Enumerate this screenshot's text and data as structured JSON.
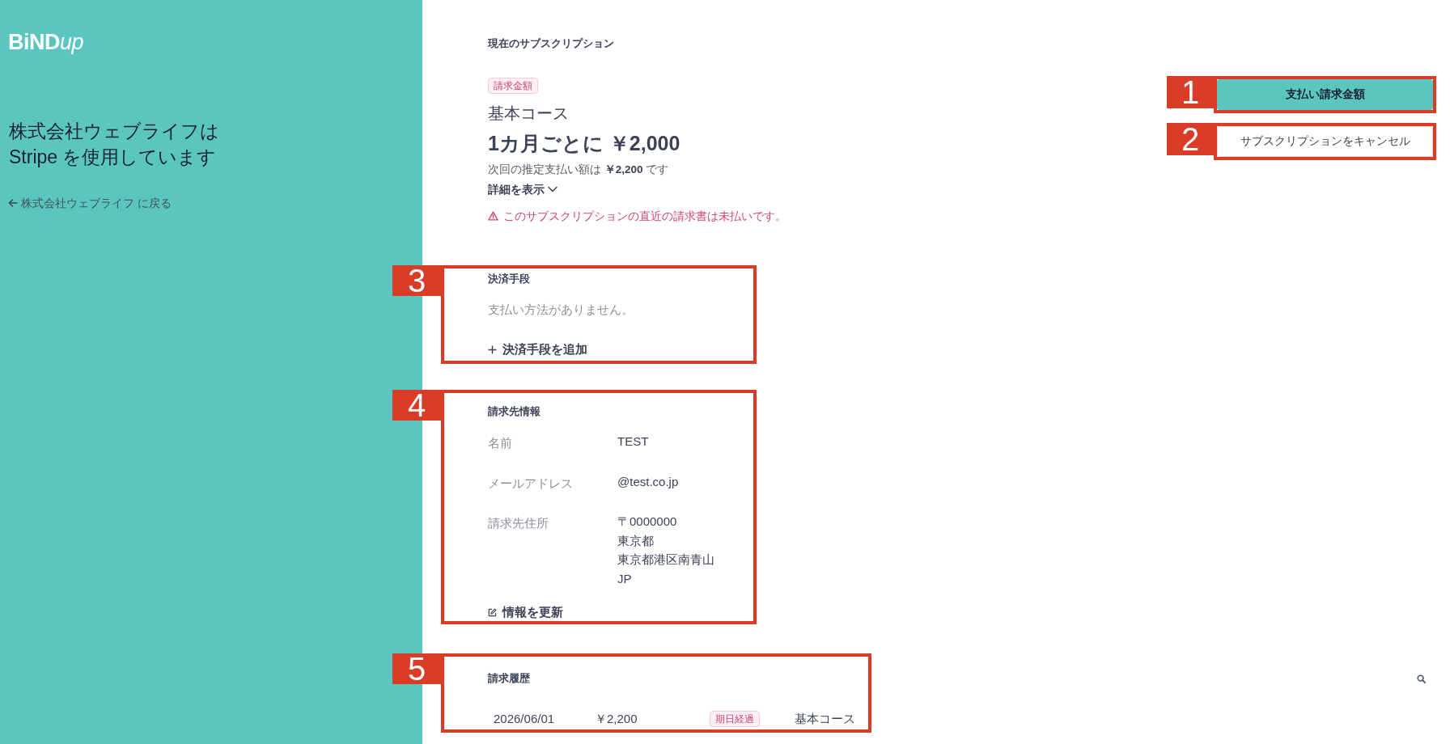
{
  "sidebar": {
    "logo": {
      "main": "BiND",
      "accent": "up"
    },
    "headline": "株式会社ウェブライフは\nStripe を使用しています",
    "back_link": "株式会社ウェブライフ に戻る"
  },
  "subscription": {
    "section_title": "現在のサブスクリプション",
    "badge": "請求金額",
    "plan_name": "基本コース",
    "price": "1カ月ごとに ￥2,000",
    "next_payment": "次回の推定支払い額は **￥2,200** です",
    "details_toggle": {
      "label": "詳細を表示",
      "expanded": false
    },
    "warning": "このサブスクリプションの直近の請求書は未払いです。"
  },
  "actions": [
    {
      "label": "支払い請求金額",
      "kind": "primary",
      "callout": "1"
    },
    {
      "label": "サブスクリプションをキャンセル",
      "kind": "secondary",
      "callout": "2"
    }
  ],
  "payment_method": {
    "title": "決済手段",
    "empty_text": "支払い方法がありません。",
    "add_link": "決済手段を追加",
    "callout": "3"
  },
  "billing_info": {
    "title": "請求先情報",
    "rows": [
      {
        "label": "名前",
        "value_lines": [
          "TEST"
        ]
      },
      {
        "label": "メールアドレス",
        "value_lines": [
          "@test.co.jp"
        ]
      },
      {
        "label": "請求先住所",
        "value_lines": [
          "〒0000000",
          "東京都",
          "東京都港区南青山",
          "JP"
        ]
      }
    ],
    "update_link": "情報を更新",
    "callout": "4"
  },
  "invoice_history": {
    "title": "請求履歴",
    "rows": [
      {
        "date": "2026/06/01",
        "amount": "￥2,200",
        "status": "期日経過",
        "description": "基本コース"
      }
    ],
    "callout": "5"
  }
}
